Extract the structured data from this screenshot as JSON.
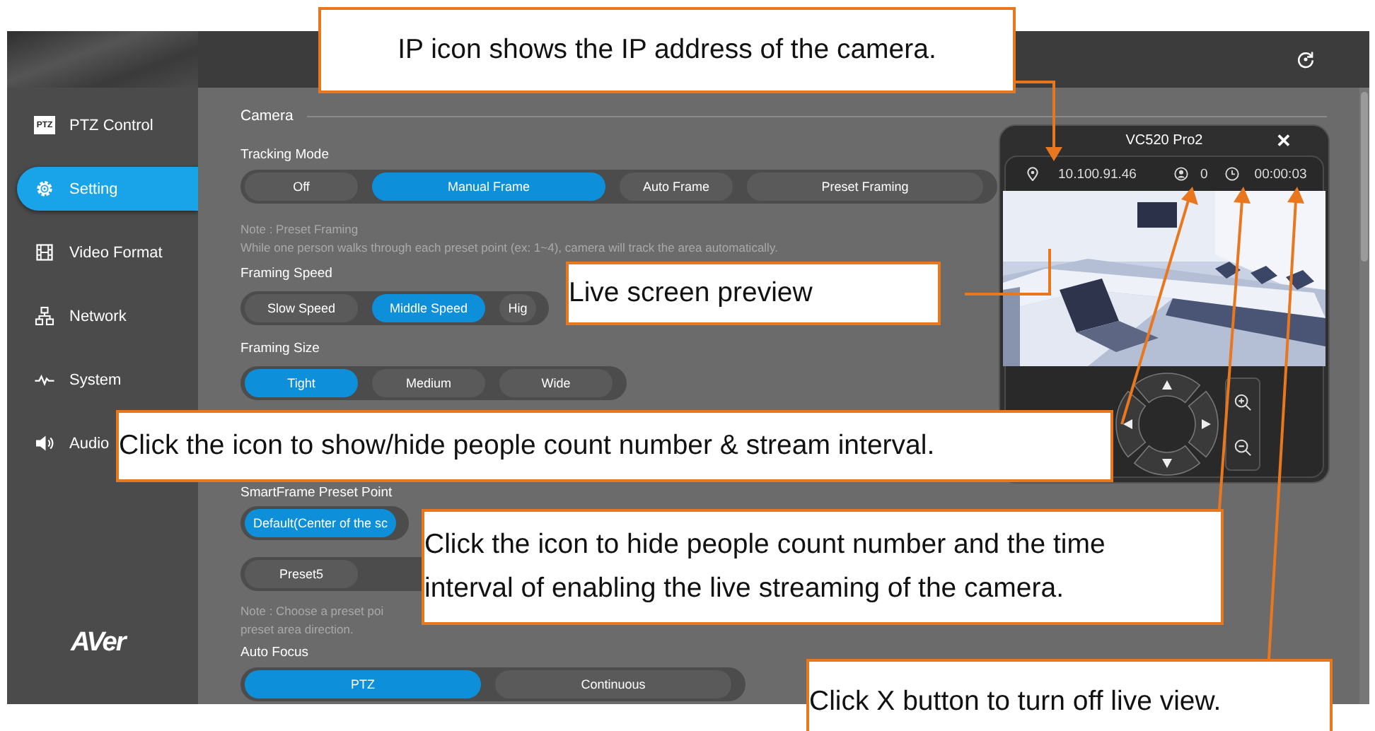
{
  "sidebar": {
    "items": [
      {
        "label": "PTZ Control",
        "badge": "PTZ",
        "selected": false
      },
      {
        "label": "Setting",
        "selected": true
      },
      {
        "label": "Video Format",
        "selected": false
      },
      {
        "label": "Network",
        "selected": false
      },
      {
        "label": "System",
        "selected": false
      },
      {
        "label": "Audio",
        "selected": false
      }
    ],
    "logo": "AVer"
  },
  "settings": {
    "section_title": "Camera",
    "rows": [
      {
        "kind": "label",
        "text": "Tracking Mode"
      },
      {
        "kind": "options",
        "options": [
          {
            "label": "Off",
            "selected": false
          },
          {
            "label": "Manual Frame",
            "selected": true
          },
          {
            "label": "Auto Frame",
            "selected": false
          },
          {
            "label": "Preset Framing",
            "selected": false
          }
        ]
      },
      {
        "kind": "note",
        "lines": [
          "Note : Preset Framing",
          "While one person walks through each preset point (ex: 1~4), camera will track the area automatically."
        ]
      },
      {
        "kind": "label",
        "text": "Framing Speed"
      },
      {
        "kind": "options",
        "options": [
          {
            "label": "Slow Speed",
            "selected": false
          },
          {
            "label": "Middle Speed",
            "selected": true
          },
          {
            "label": "Hig",
            "selected": false
          }
        ]
      },
      {
        "kind": "label",
        "text": "Framing Size"
      },
      {
        "kind": "options",
        "options": [
          {
            "label": "Tight",
            "selected": true
          },
          {
            "label": "Medium",
            "selected": false
          },
          {
            "label": "Wide",
            "selected": false
          }
        ]
      },
      {
        "kind": "label",
        "text": "SmartFrame Preset Point"
      },
      {
        "kind": "options",
        "options": [
          {
            "label": "Default(Center of the sc",
            "selected": true
          }
        ]
      },
      {
        "kind": "options",
        "options": [
          {
            "label": "Preset5",
            "selected": false
          }
        ]
      },
      {
        "kind": "note",
        "lines": [
          "Note : Choose a preset poi",
          "preset area direction."
        ]
      },
      {
        "kind": "label",
        "text": "Auto Focus"
      },
      {
        "kind": "options",
        "options": [
          {
            "label": "PTZ",
            "selected": true
          },
          {
            "label": "Continuous",
            "selected": false
          }
        ]
      }
    ]
  },
  "preview": {
    "title": "VC520 Pro2",
    "close": "✕",
    "ip": "10.100.91.46",
    "people_count": "0",
    "elapsed": "00:00:03"
  },
  "callouts": [
    {
      "lines": [
        "IP icon shows the IP address of the camera."
      ]
    },
    {
      "lines": [
        "Live screen preview"
      ]
    },
    {
      "lines": [
        "Click the icon to show/hide people count number & stream interval."
      ]
    },
    {
      "lines": [
        "Click the icon to hide people count number and the time",
        "interval of enabling the live streaming of the camera."
      ]
    },
    {
      "lines": [
        "Click X button to turn off live view."
      ]
    }
  ]
}
